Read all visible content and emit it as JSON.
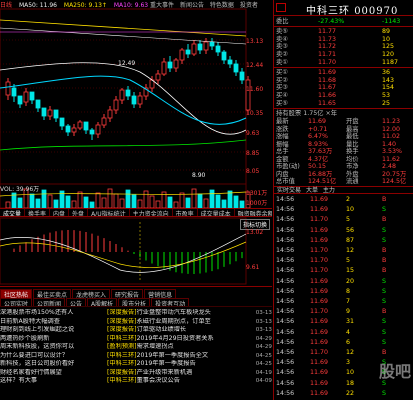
{
  "ma_legend": [
    {
      "label": "日线",
      "color": "#ff3c3c"
    },
    {
      "label": "MA50: 11.96",
      "color": "#ffffff"
    },
    {
      "label": "MA250: 9.13↑",
      "color": "#ffe000"
    },
    {
      "label": "MA10: 9.63",
      "color": "#ff44ff"
    }
  ],
  "top_tabs": [
    "重大事件",
    "新闻公告",
    "特色数据",
    "投资者"
  ],
  "y_axis_ticks": [
    "13.13",
    "12.44",
    "11.60",
    "10.35",
    "9.63",
    "8.85",
    "8.05"
  ],
  "price_labels": {
    "high": "12.49",
    "low": "8.90"
  },
  "vol_legend": "VOL: 39.96万",
  "vol_axis": [
    "1301万",
    "1000万",
    "500万",
    "0"
  ],
  "indicator_tabs": [
    "成交量",
    "换手率",
    "内盘",
    "外盘",
    "A/U指标统计",
    "主力资金流向",
    "市盈率",
    "成交量成本",
    "融资融券余额"
  ],
  "macd_axis": [
    "13.02",
    "9.61"
  ],
  "macd_label": "指标切换",
  "news_tabs1": [
    "社区热帖",
    "最佳买卖点",
    "龙虎榜买入",
    "研究报告",
    "营销信息"
  ],
  "news_tabs2": [
    "公司实时",
    "公司新闻",
    "公告",
    "A股解析",
    "股市分析",
    "投资者互动"
  ],
  "news_left": [
    {
      "text": "深港股票市场150%还有人",
      "time": ""
    },
    {
      "text": "日前新A股特大幅调查",
      "time": ""
    },
    {
      "text": "理财刻到线上引发崛起之说",
      "time": ""
    },
    {
      "text": "两遭热炒个股刷新",
      "time": ""
    },
    {
      "text": "周末新科技股，这资你可以",
      "time": ""
    },
    {
      "text": "为什么要进口可以设计？",
      "time": ""
    },
    {
      "text": "新科技，这日公司股价看好",
      "time": ""
    },
    {
      "text": "财经名家看好行情展望",
      "time": ""
    },
    {
      "text": "这样？有大事",
      "time": ""
    }
  ],
  "news_right": [
    {
      "tag": "[深度报告]",
      "text": "行业盘整带动汽车板块龙头",
      "time": "03-13"
    },
    {
      "tag": "[深度报告]",
      "text": "永磁行业周期拐点，订单至",
      "time": "03-13"
    },
    {
      "tag": "[深度报告]",
      "text": "订单驱动业绩增长",
      "time": "03-13"
    },
    {
      "tag": "[中科三环]",
      "text": "2019年4月29日投资者关系",
      "time": "04-29"
    },
    {
      "tag": "[盈利预测]",
      "text": "需求增速拐点",
      "time": "04-29"
    },
    {
      "tag": "[中科三环]",
      "text": "2019年第一季度报告全文",
      "time": "04-25"
    },
    {
      "tag": "[中科三环]",
      "text": "2019年第一季度报告",
      "time": "04-25"
    },
    {
      "tag": "[深度报告]",
      "text": "产业升级带来新机遇",
      "time": "04-19"
    },
    {
      "tag": "[中科三环]",
      "text": "董事会决议公告",
      "time": "04-09"
    }
  ],
  "stock": {
    "name": "中科三环",
    "code": "000970"
  },
  "order_book": {
    "header": "委比",
    "header_val": "-27.43%",
    "header_diff": "-1143",
    "sells": [
      {
        "label": "卖⑤",
        "price": "11.77",
        "vol": "89"
      },
      {
        "label": "卖④",
        "price": "11.73",
        "vol": "10"
      },
      {
        "label": "卖③",
        "price": "11.72",
        "vol": "125"
      },
      {
        "label": "卖②",
        "price": "11.71",
        "vol": "120"
      },
      {
        "label": "卖①",
        "price": "11.70",
        "vol": "1187"
      }
    ],
    "buys": [
      {
        "label": "买①",
        "price": "11.69",
        "vol": "36"
      },
      {
        "label": "买②",
        "price": "11.68",
        "vol": "143"
      },
      {
        "label": "买③",
        "price": "11.67",
        "vol": "154"
      },
      {
        "label": "买④",
        "price": "11.66",
        "vol": "53"
      },
      {
        "label": "买⑤",
        "price": "11.65",
        "vol": "25"
      }
    ]
  },
  "quote_head": "持有股票 1.75亿 ×年",
  "quote": [
    {
      "a": "最新",
      "b": "11.69",
      "c": "开盘",
      "d": "11.23"
    },
    {
      "a": "涨跌",
      "b": "+0.71",
      "c": "最高",
      "d": "12.00"
    },
    {
      "a": "涨幅",
      "b": "6.47%",
      "c": "最低",
      "d": "11.02"
    },
    {
      "a": "振幅",
      "b": "8.93%",
      "c": "量比",
      "d": "1.40"
    },
    {
      "a": "总手",
      "b": "37.63万",
      "c": "换手",
      "d": "3.53%"
    },
    {
      "a": "金额",
      "b": "4.37亿",
      "c": "均价",
      "d": "11.62"
    },
    {
      "a": "市盈(动)",
      "b": "50.15",
      "c": "市净",
      "d": "2.48"
    },
    {
      "a": "内盘",
      "b": "16.88万",
      "c": "外盘",
      "d": "20.75万"
    },
    {
      "a": "总市值",
      "b": "124.51亿",
      "c": "流通",
      "d": "124.5亿"
    }
  ],
  "side_tab": [
    "实时交易",
    "大单",
    "主力"
  ],
  "ticks": [
    {
      "t": "14:56",
      "p": "11.69",
      "v": "2",
      "bs": "B"
    },
    {
      "t": "14:56",
      "p": "11.69",
      "v": "10",
      "bs": "S"
    },
    {
      "t": "14:56",
      "p": "11.70",
      "v": "5",
      "bs": "B"
    },
    {
      "t": "14:56",
      "p": "11.69",
      "v": "56",
      "bs": "S"
    },
    {
      "t": "14:56",
      "p": "11.69",
      "v": "87",
      "bs": "S"
    },
    {
      "t": "14:56",
      "p": "11.70",
      "v": "12",
      "bs": "B"
    },
    {
      "t": "14:56",
      "p": "11.70",
      "v": "5",
      "bs": "B"
    },
    {
      "t": "14:56",
      "p": "11.70",
      "v": "15",
      "bs": "B"
    },
    {
      "t": "14:56",
      "p": "11.69",
      "v": "20",
      "bs": "S"
    },
    {
      "t": "14:56",
      "p": "11.69",
      "v": "8",
      "bs": "S"
    },
    {
      "t": "14:56",
      "p": "11.69",
      "v": "7",
      "bs": "S"
    },
    {
      "t": "14:56",
      "p": "11.70",
      "v": "9",
      "bs": "B"
    },
    {
      "t": "14:56",
      "p": "11.69",
      "v": "31",
      "bs": "S"
    },
    {
      "t": "14:56",
      "p": "11.69",
      "v": "4",
      "bs": "S"
    },
    {
      "t": "14:56",
      "p": "11.69",
      "v": "6",
      "bs": "S"
    },
    {
      "t": "14:56",
      "p": "11.70",
      "v": "12",
      "bs": "B"
    },
    {
      "t": "14:56",
      "p": "11.69",
      "v": "3",
      "bs": "S"
    },
    {
      "t": "14:56",
      "p": "11.69",
      "v": "10",
      "bs": "S"
    },
    {
      "t": "14:56",
      "p": "11.69",
      "v": "18",
      "bs": "S"
    },
    {
      "t": "14:56",
      "p": "11.69",
      "v": "22",
      "bs": "S"
    }
  ],
  "watermark": "股吧"
}
